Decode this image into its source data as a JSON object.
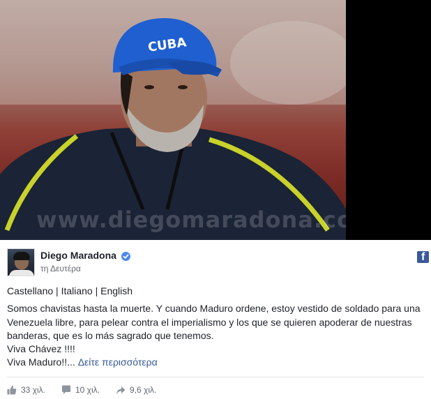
{
  "photo": {
    "cap_text": "CUBA",
    "watermark": "www.diegomaradona.com",
    "icon": "photo-of-man-in-blue-cap"
  },
  "post": {
    "author": "Diego Maradona",
    "time": "τη Δευτέρα",
    "languages": "Castellano | Italiano | English",
    "lines": [
      "Somos chavistas hasta la muerte. Y cuando Maduro ordene, estoy vestido de soldado para una",
      "Venezuela libre, para pelear contra el imperialismo y los que se quieren apoderar de nuestras",
      "banderas, que es lo más sagrado que tenemos.",
      "Viva Chávez !!!!"
    ],
    "last_line_prefix": "Viva Maduro!!...",
    "see_more": "Δείτε περισσότερα"
  },
  "stats": {
    "likes": "33 χιλ.",
    "comments": "10 χιλ.",
    "shares": "9,6 χιλ."
  },
  "colors": {
    "link": "#365899",
    "facebook": "#3b5998",
    "verified": "#4b88f1",
    "cap": "#1f5fd0"
  }
}
